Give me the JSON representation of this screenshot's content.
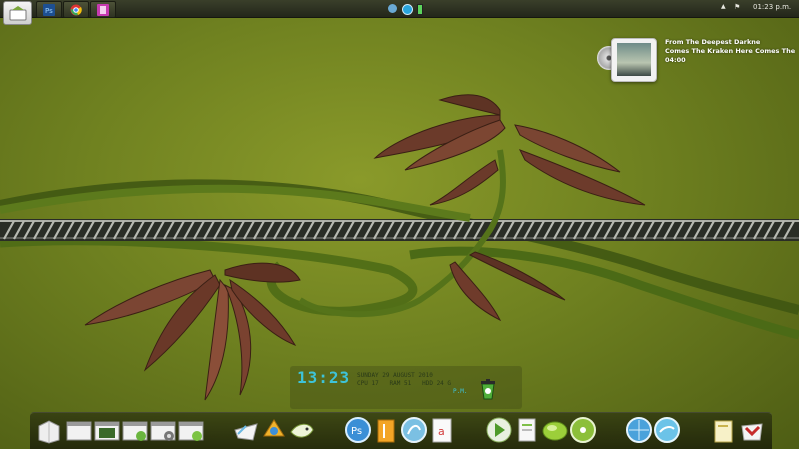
{
  "taskbar": {
    "start_button": "start-icon",
    "tasks": [
      "photoshop-icon",
      "chrome-icon",
      "notes-icon"
    ],
    "tray_icons": [
      "network-icon",
      "skype-icon",
      "battery-icon"
    ],
    "language_icon": "chevron-up-icon",
    "flag_icon": "flag-icon",
    "time": "01:23 p.m."
  },
  "now_playing": {
    "line1": "From The Deepest Darkne",
    "line2": "Comes The Kraken    Here Comes The",
    "elapsed": "04:00"
  },
  "clock": {
    "time": "13:23",
    "date": "SUNDAY 29 AUGUST 2010",
    "cpu_label": "CPU",
    "cpu_value": "17",
    "ram_label": "RAM",
    "ram_value": "51",
    "hdd_label": "HDD",
    "hdd_value": "24 G",
    "ampm": "P.M."
  },
  "dock": {
    "icons": [
      "computer-icon",
      "window-icon",
      "photo-window-icon",
      "download-window-icon",
      "settings-window-icon",
      "global-window-icon",
      "mail-icon",
      "messenger-icon",
      "bird-icon",
      "photoshop-icon",
      "illustrator-icon",
      "dreamweaver-icon",
      "acrobat-icon",
      "media-player-icon",
      "document-icon",
      "itunes-icon",
      "dvd-icon",
      "browser-icon",
      "twitter-icon",
      "folder-icon",
      "mail-client-icon"
    ]
  }
}
